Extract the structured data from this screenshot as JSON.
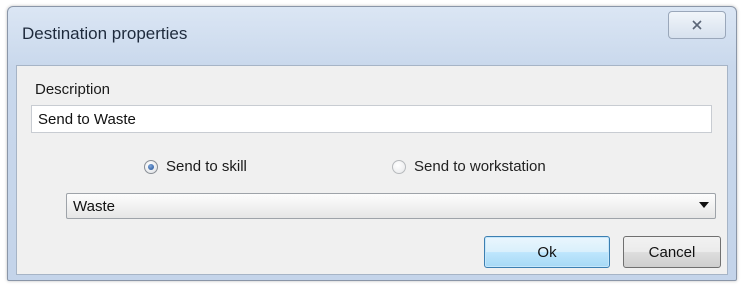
{
  "window": {
    "title": "Destination properties",
    "close_icon": "close-x-icon"
  },
  "description": {
    "label": "Description",
    "value": "Send to Waste"
  },
  "send_options": {
    "skill": {
      "label": "Send to skill",
      "selected": true
    },
    "workstation": {
      "label": "Send to workstation",
      "selected": false
    }
  },
  "destination_select": {
    "selected": "Waste",
    "arrow_icon": "dropdown-arrow-icon"
  },
  "buttons": {
    "ok_label": "Ok",
    "cancel_label": "Cancel"
  },
  "colors": {
    "title_bar": "#c9d8ec",
    "client_bg": "#f0f0f0",
    "ok_button": "#bee6fd",
    "radio_dot": "#1d4e96"
  }
}
